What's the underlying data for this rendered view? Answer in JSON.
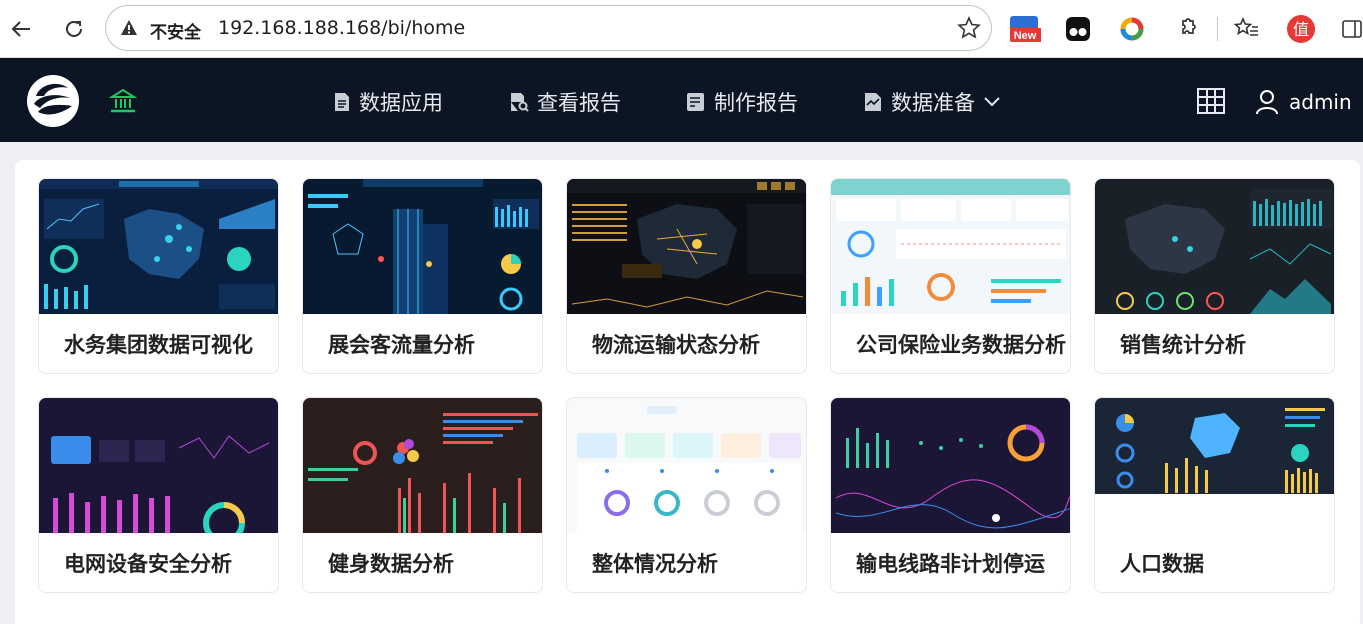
{
  "browser": {
    "insecure_label": "不安全",
    "url": "192.168.188.168/bi/home",
    "new_badge": "New",
    "zhi_label": "值"
  },
  "header": {
    "nav": [
      {
        "label": "数据应用",
        "icon": "document-icon"
      },
      {
        "label": "查看报告",
        "icon": "report-search-icon"
      },
      {
        "label": "制作报告",
        "icon": "edit-report-icon"
      },
      {
        "label": "数据准备",
        "icon": "data-prep-icon",
        "has_dropdown": true
      }
    ],
    "username": "admin"
  },
  "cards": [
    {
      "title": "水务集团数据可视化",
      "theme": "dark-navy"
    },
    {
      "title": "展会客流量分析",
      "theme": "dark-navy"
    },
    {
      "title": "物流运输状态分析",
      "theme": "dark-black"
    },
    {
      "title": "公司保险业务数据分析",
      "theme": "light-teal"
    },
    {
      "title": "销售统计分析",
      "theme": "dark-slate"
    },
    {
      "title": "电网设备安全分析",
      "theme": "dark-purple"
    },
    {
      "title": "健身数据分析",
      "theme": "dark-brown"
    },
    {
      "title": "整体情况分析",
      "theme": "light"
    },
    {
      "title": "输电线路非计划停运",
      "theme": "dark-purple"
    },
    {
      "title": "人口数据",
      "theme": "dark-slate"
    }
  ],
  "colors": {
    "header_bg": "#0b1523",
    "home_icon": "#22c55e",
    "page_bg": "#eef0f4"
  }
}
